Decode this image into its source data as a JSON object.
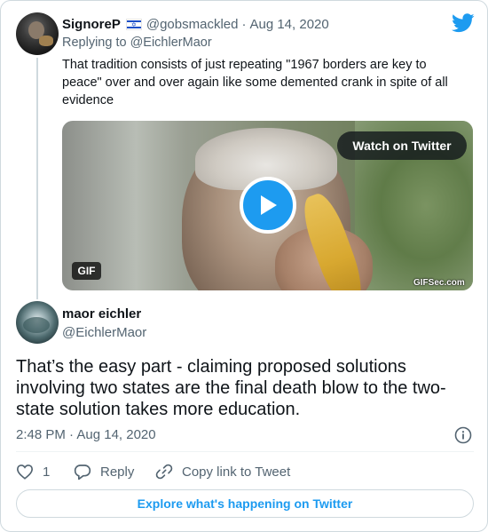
{
  "parent_tweet": {
    "display_name": "SignoreP",
    "flag_icon": "israel-flag-icon",
    "handle": "@gobsmackled",
    "separator": "·",
    "date": "Aug 14, 2020",
    "replying_to": "Replying to @EichlerMaor",
    "text": "That tradition consists of just repeating \"1967 borders are key to peace\" over and over again like some demented crank in spite of all evidence",
    "media": {
      "watch_label": "Watch on Twitter",
      "badge": "GIF",
      "watermark": "GIFSec.com",
      "play_icon": "play-icon"
    }
  },
  "main_tweet": {
    "display_name": "maor eichler",
    "handle": "@EichlerMaor",
    "text": "That’s the easy part - claiming proposed solutions involving two states are the final death blow to the two-state solution takes more education.",
    "timestamp": "2:48 PM · Aug 14, 2020",
    "actions": {
      "like_count": "1",
      "reply_label": "Reply",
      "copy_link_label": "Copy link to Tweet"
    },
    "explore_label": "Explore what's happening on Twitter"
  },
  "colors": {
    "twitter_blue": "#1d9bf0",
    "text_primary": "#0f1419",
    "text_secondary": "#536471",
    "border": "#cfd9de"
  }
}
